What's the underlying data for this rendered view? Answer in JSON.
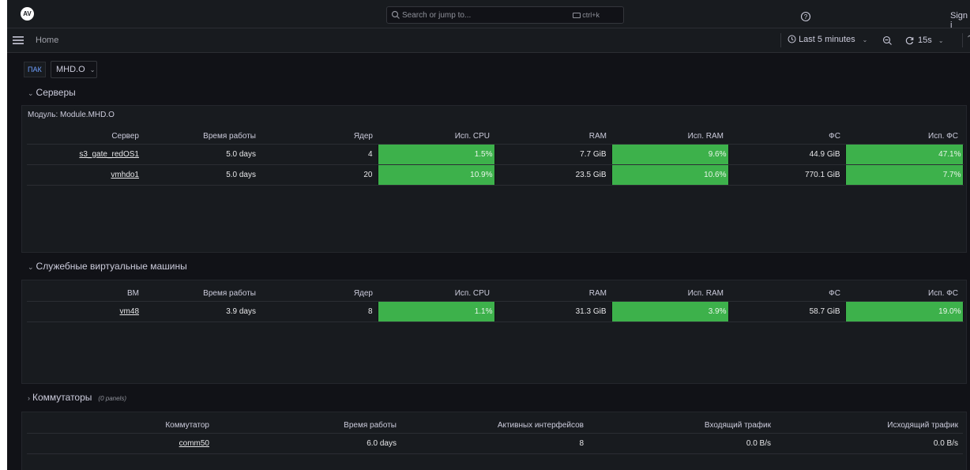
{
  "topbar": {
    "logo": "AV",
    "search_placeholder": "Search or jump to...",
    "search_shortcut": "ctrl+k",
    "signin": "Sign i"
  },
  "navbar": {
    "breadcrumb": "Home",
    "time_range": "Last 5 minutes",
    "refresh_interval": "15s"
  },
  "variables": {
    "label": "ПАК",
    "value": "MHD.O"
  },
  "servers_row": {
    "title": "Серверы",
    "panel_title": "Модуль: Module.MHD.O",
    "columns": [
      "Сервер",
      "Время работы",
      "Ядер",
      "Исп. CPU",
      "RAM",
      "Исп. RAM",
      "ФС",
      "Исп. ФС"
    ],
    "rows": [
      [
        "s3_gate_redOS1",
        "5.0 days",
        "4",
        "1.5%",
        "7.7 GiB",
        "9.6%",
        "44.9 GiB",
        "47.1%"
      ],
      [
        "vmhdo1",
        "5.0 days",
        "20",
        "10.9%",
        "23.5 GiB",
        "10.6%",
        "770.1 GiB",
        "7.7%"
      ]
    ]
  },
  "vms_row": {
    "title": "Служебные виртуальные машины",
    "columns": [
      "ВМ",
      "Время работы",
      "Ядер",
      "Исп. CPU",
      "RAM",
      "Исп. RAM",
      "ФС",
      "Исп. ФС"
    ],
    "rows": [
      [
        "vm48",
        "3.9 days",
        "8",
        "1.1%",
        "31.3 GiB",
        "3.9%",
        "58.7 GiB",
        "19.0%"
      ]
    ]
  },
  "switches_row": {
    "title": "Коммутаторы",
    "panels_note": "(0 panels)",
    "columns": [
      "Коммутатор",
      "Время работы",
      "Активных интерфейсов",
      "Входящий трафик",
      "Исходящий трафик"
    ],
    "rows": [
      [
        "comm50",
        "6.0 days",
        "8",
        "0.0 B/s",
        "0.0 B/s"
      ]
    ]
  },
  "colors": {
    "background": "#111217",
    "panel": "#181b1f",
    "gauge_green": "#3db14b",
    "variable_label": "#6e9fff"
  }
}
